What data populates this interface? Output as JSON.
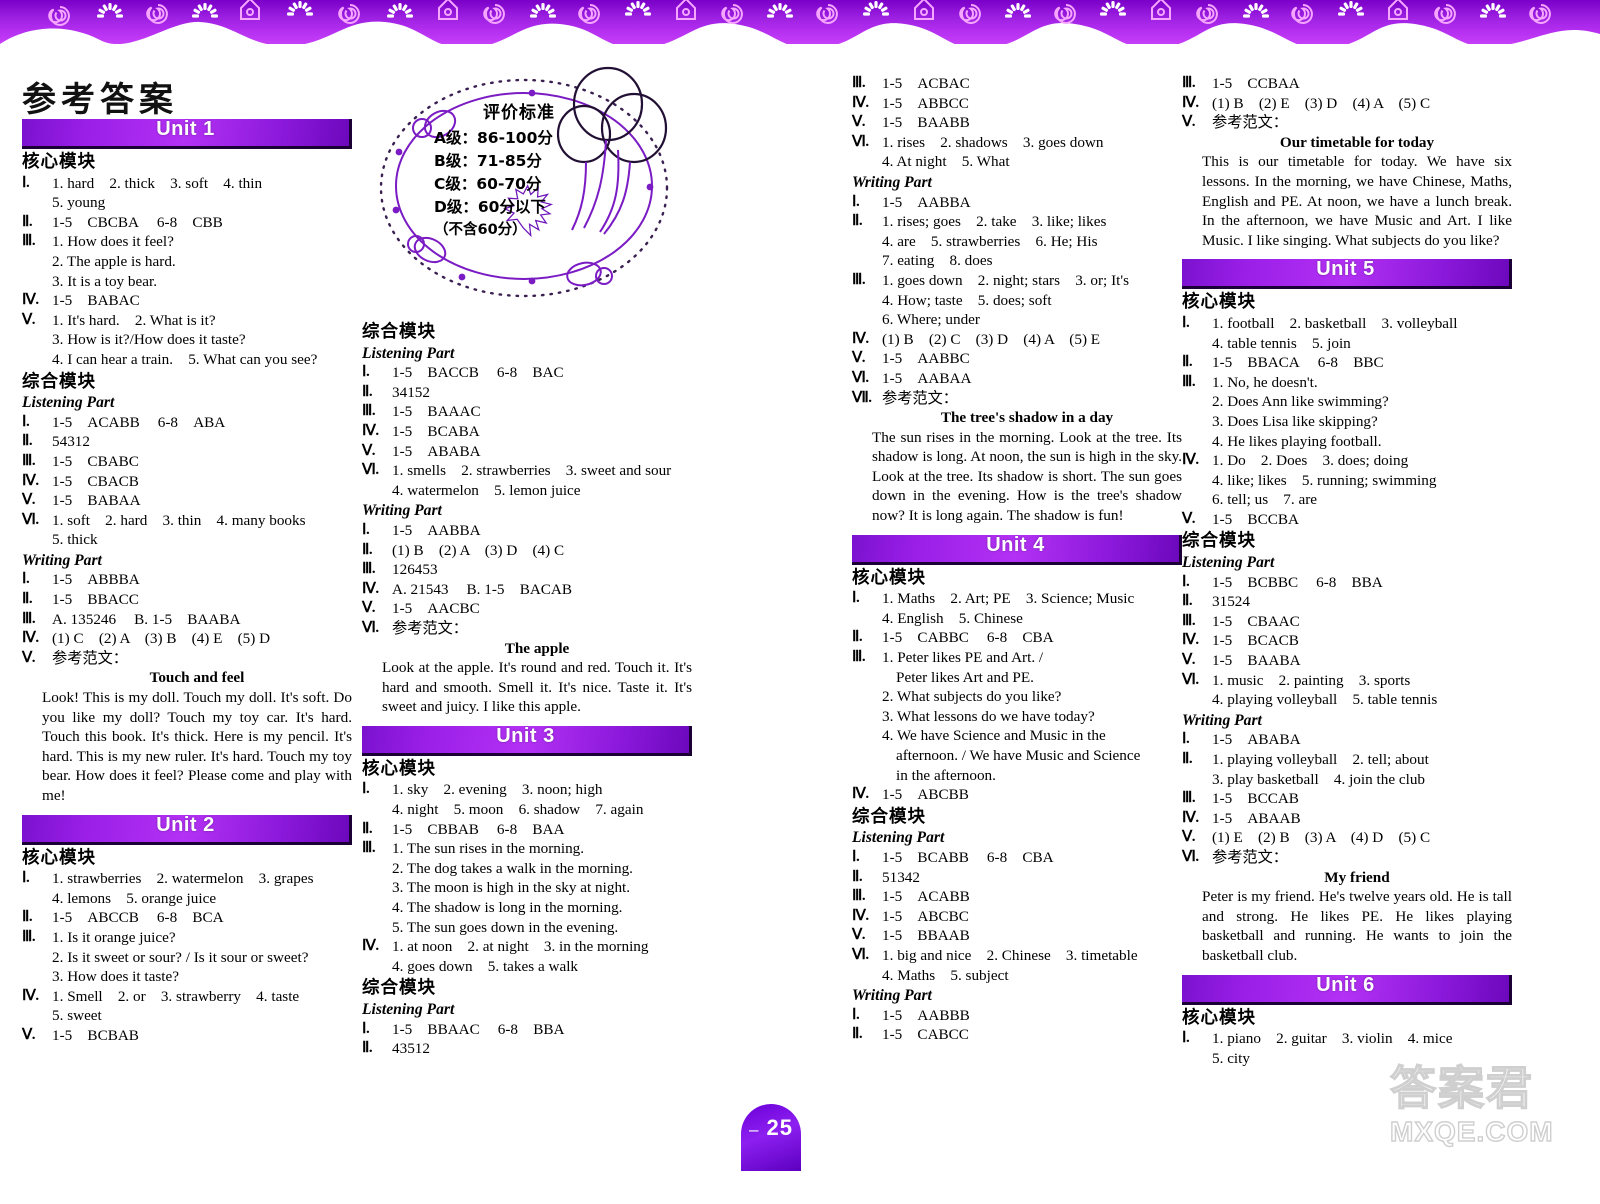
{
  "page": {
    "title": "参考答案",
    "number": "25",
    "watermark_cn": "答案君",
    "watermark_en": "MXQE.COM"
  },
  "colors": {
    "banner_purple": "#9b1fe8",
    "border_purple": "#7a00c8",
    "page_num_purple": "#6a00d8"
  },
  "evaluation": {
    "title": "评价标准",
    "lines": [
      "A级：86-100分",
      "B级：71-85分",
      "C级：60-70分",
      "D级：60分以下"
    ],
    "note": "（不含60分）"
  },
  "labels": {
    "core_module": "核心模块",
    "comprehensive_module": "综合模块",
    "listening_part": "Listening Part",
    "writing_part": "Writing Part",
    "sample_essay": "参考范文："
  },
  "units": {
    "unit1": "Unit 1",
    "unit2": "Unit 2",
    "unit3": "Unit 3",
    "unit4": "Unit 4",
    "unit5": "Unit 5",
    "unit6": "Unit 6"
  },
  "numerals": {
    "i": "Ⅰ",
    "ii": "Ⅱ",
    "iii": "Ⅲ",
    "iv": "Ⅳ",
    "v": "Ⅴ",
    "vi": "Ⅵ",
    "vii": "Ⅶ"
  },
  "u1_core": {
    "i_a": "1. hard　2. thick　3. soft　4. thin",
    "i_b": "5. young",
    "ii": "1-5　CBCBA",
    "ii2": "6-8　CBB",
    "iii_1": "1. How does it feel?",
    "iii_2": "2. The apple is hard.",
    "iii_3": "3. It is a toy bear.",
    "iv": "1-5　BABAC",
    "v_1": "1. It's hard.　2. What is it?",
    "v_2": "3. How is it?/How does it taste?",
    "v_3": "4. I can hear a train.　5. What can you see?"
  },
  "u1_comp": {
    "l_i": "1-5　ACABB",
    "l_i2": "6-8　ABA",
    "l_ii": "54312",
    "l_iii": "1-5　CBABC",
    "l_iv": "1-5　CBACB",
    "l_v": "1-5　BABAA",
    "l_vi_a": "1. soft　2. hard　3. thin　4. many books",
    "l_vi_b": "5. thick",
    "w_i": "1-5　ABBBA",
    "w_ii": "1-5　BBACC",
    "w_iii": "A. 135246",
    "w_iii2": "B. 1-5　BAABA",
    "w_iv": "(1) C　(2) A　(3) B　(4) E　(5) D",
    "w_v_title": "Touch and feel",
    "w_v_body": "Look! This is my doll. Touch my doll. It's soft. Do you like my doll? Touch my toy car. It's hard. Touch this book. It's thick. Here is my pencil. It's hard. This is my new ruler. It's hard. Touch my toy bear. How does it feel? Please come and play with me!"
  },
  "u2_core": {
    "i_a": "1. strawberries　2. watermelon　3. grapes",
    "i_b": "4. lemons　5. orange juice",
    "ii": "1-5　ABCCB",
    "ii2": "6-8　BCA",
    "iii_1": "1. Is it orange juice?",
    "iii_2": "2. Is it sweet or sour? / Is it sour or sweet?",
    "iii_3": "3. How does it taste?",
    "iv_a": "1. Smell　2. or　3. strawberry　4. taste",
    "iv_b": "5. sweet",
    "v": "1-5　BCBAB"
  },
  "u2_comp": {
    "l_i": "1-5　BACCB",
    "l_i2": "6-8　BAC",
    "l_ii": "34152",
    "l_iii": "1-5　BAAAC",
    "l_iv": "1-5　BCABA",
    "l_v": "1-5　ABABA",
    "l_vi_a": "1. smells　2. strawberries　3. sweet and sour",
    "l_vi_b": "4. watermelon　5. lemon juice",
    "w_i": "1-5　AABBA",
    "w_ii": "(1) B　(2) A　(3) D　(4) C",
    "w_iii": "126453",
    "w_iv": "A. 21543",
    "w_iv2": "B. 1-5　BACAB",
    "w_v": "1-5　AACBC",
    "w_vi_title": "The apple",
    "w_vi_body": "Look at the apple. It's round and red. Touch it. It's hard and smooth. Smell it. It's nice. Taste it. It's sweet and juicy. I like this apple."
  },
  "u3_core": {
    "i_a": "1. sky　2. evening　3. noon; high",
    "i_b": "4. night　5. moon　6. shadow　7. again",
    "ii": "1-5　CBBAB",
    "ii2": "6-8　BAA",
    "iii_1": "1. The sun rises in the morning.",
    "iii_2": "2. The dog takes a walk in the morning.",
    "iii_3": "3. The moon is high in the sky at night.",
    "iii_4": "4. The shadow is long in the morning.",
    "iii_5": "5. The sun goes down in the evening.",
    "iv_a": "1. at noon　2. at night　3. in the morning",
    "iv_b": "4. goes down　5. takes a walk"
  },
  "u3_comp": {
    "l_i": "1-5　BBAAC",
    "l_i2": "6-8　BBA",
    "l_ii": "43512",
    "l_iii": "1-5　ACBAC",
    "l_iv": "1-5　ABBCC",
    "l_v": "1-5　BAABB",
    "l_vi_a": "1. rises　2. shadows　3. goes down",
    "l_vi_b": "4. At night　5. What",
    "w_i": "1-5　AABBA",
    "w_ii_a": "1. rises; goes　2. take　3. like; likes",
    "w_ii_b": "4. are　5. strawberries　6. He; His",
    "w_ii_c": "7. eating　8. does",
    "w_iii_a": "1. goes down　2. night; stars　3. or; It's",
    "w_iii_b": "4. How; taste　5. does; soft",
    "w_iii_c": "6. Where; under",
    "w_iv": "(1) B　(2) C　(3) D　(4) A　(5) E",
    "w_v": "1-5　AABBC",
    "w_vi": "1-5　AABAA",
    "w_vii_title": "The tree's shadow in a day",
    "w_vii_body": "The sun rises in the morning. Look at the tree. Its shadow is long. At noon, the sun is high in the sky. Look at the tree. Its shadow is short. The sun goes down in the evening. How is the tree's shadow now? It is long again. The shadow is fun!"
  },
  "u4_core": {
    "i_a": "1. Maths　2. Art; PE　3. Science; Music",
    "i_b": "4. English　5. Chinese",
    "ii": "1-5　CABBC",
    "ii2": "6-8　CBA",
    "iii_1a": "1. Peter likes PE and Art. /",
    "iii_1b": "Peter likes Art and PE.",
    "iii_2": "2. What subjects do you like?",
    "iii_3": "3. What lessons do we have today?",
    "iii_4a": "4. We have Science and Music in the",
    "iii_4b": "afternoon. / We have Music and Science",
    "iii_4c": "in the afternoon.",
    "iv": "1-5　ABCBB"
  },
  "u4_comp": {
    "l_i": "1-5　BCABB",
    "l_i2": "6-8　CBA",
    "l_ii": "51342",
    "l_iii": "1-5　ACABB",
    "l_iv": "1-5　ABCBC",
    "l_v": "1-5　BBAAB",
    "l_vi_a": "1. big and nice　2. Chinese　3. timetable",
    "l_vi_b": "4. Maths　5. subject",
    "w_i": "1-5　AABBB",
    "w_ii": "1-5　CABCC",
    "w_iii": "1-5　CCBAA",
    "w_iv": "(1) B　(2) E　(3) D　(4) A　(5) C",
    "w_v_title": "Our timetable for today",
    "w_v_body": "This is our timetable for today. We have six lessons. In the morning, we have Chinese, Maths, English and PE. At noon, we have a lunch break. In the afternoon, we have Music and Art. I like Music. I like singing. What subjects do you like?"
  },
  "u5_core": {
    "i_a": "1. football　2. basketball　3. volleyball",
    "i_b": "4. table tennis　5. join",
    "ii": "1-5　BBACA",
    "ii2": "6-8　BBC",
    "iii_1": "1. No, he doesn't.",
    "iii_2": "2. Does Ann like swimming?",
    "iii_3": "3. Does Lisa like skipping?",
    "iii_4": "4. He likes playing football.",
    "iv_a": "1. Do　2. Does　3. does; doing",
    "iv_b": "4. like; likes　5. running; swimming",
    "iv_c": "6. tell; us　7. are",
    "v": "1-5　BCCBA"
  },
  "u5_comp": {
    "l_i": "1-5　BCBBC",
    "l_i2": "6-8　BBA",
    "l_ii": "31524",
    "l_iii": "1-5　CBAAC",
    "l_iv": "1-5　BCACB",
    "l_v": "1-5　BAABA",
    "l_vi_a": "1. music　2. painting　3. sports",
    "l_vi_b": "4. playing volleyball　5. table tennis",
    "w_i": "1-5　ABABA",
    "w_ii_a": "1. playing volleyball　2. tell; about",
    "w_ii_b": "3. play basketball　4. join the club",
    "w_iii": "1-5　BCCAB",
    "w_iv": "1-5　ABAAB",
    "w_v": "(1) E　(2) B　(3) A　(4) D　(5) C",
    "w_vi_title": "My friend",
    "w_vi_body": "Peter is my friend. He's twelve years old. He is tall and strong. He likes PE. He likes playing basketball and running. He wants to join the basketball club."
  },
  "u6_core": {
    "i_a": "1. piano　2. guitar　3. violin　4. mice",
    "i_b": "5. city"
  }
}
